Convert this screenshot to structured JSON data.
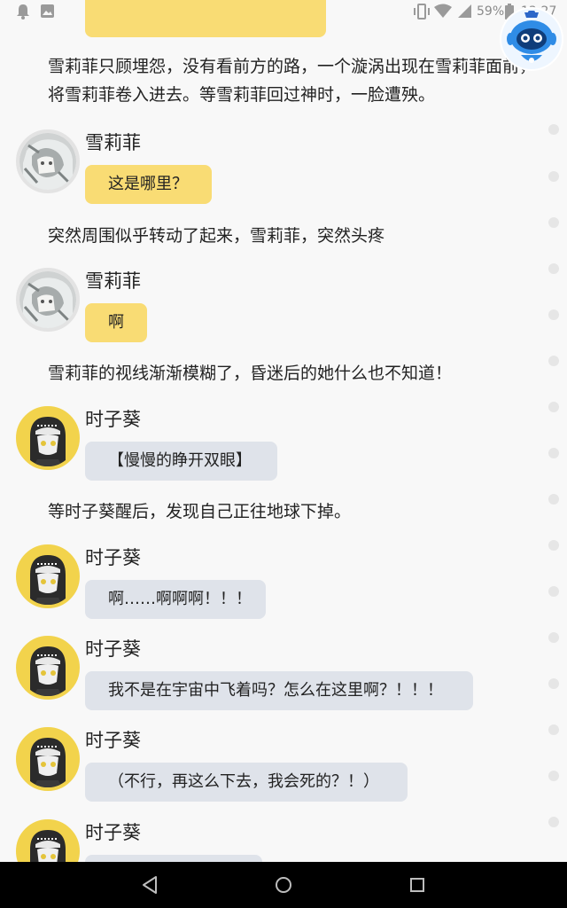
{
  "status_bar": {
    "icons": [
      "notification-icon",
      "photo-icon",
      "vibrate-icon",
      "wifi-icon",
      "signal-icon",
      "battery-icon"
    ],
    "battery": "59%",
    "time": "13:27"
  },
  "floating_assistant": {
    "icon": "robot-icon",
    "accent": "#2f8ce6"
  },
  "story": {
    "narration_1": "雪莉菲只顾埋怨，没有看前方的路，一个漩涡出现在雪莉菲面前，将雪莉菲卷入进去。等雪莉菲回过神时，一脸遭殃。",
    "msg_1": {
      "speaker": "雪莉菲",
      "text": "这是哪里？"
    },
    "narration_2": "突然周围似乎转动了起来，雪莉菲，突然头疼",
    "msg_2": {
      "speaker": "雪莉菲",
      "text": "啊"
    },
    "narration_3": "雪莉菲的视线渐渐模糊了，昏迷后的她什么也不知道！",
    "msg_3": {
      "speaker": "时子葵",
      "text": "【慢慢的睁开双眼】"
    },
    "narration_4": "等时子葵醒后，发现自己正往地球下掉。",
    "msg_4": {
      "speaker": "时子葵",
      "text": "啊……啊啊啊！！！"
    },
    "msg_5": {
      "speaker": "时子葵",
      "text": "我不是在宇宙中飞着吗？怎么在这里啊？！！！"
    },
    "msg_6": {
      "speaker": "时子葵",
      "text": "（不行，再这么下去，我会死的？！）"
    },
    "msg_7": {
      "speaker": "时子葵",
      "text": ""
    }
  },
  "colors": {
    "yellow_bubble": "#f9dc74",
    "grey_bubble": "#dfe3ea",
    "background": "#f8f8f8"
  },
  "nav_bar": {
    "icons": [
      "back-icon",
      "home-icon",
      "recents-icon"
    ]
  }
}
